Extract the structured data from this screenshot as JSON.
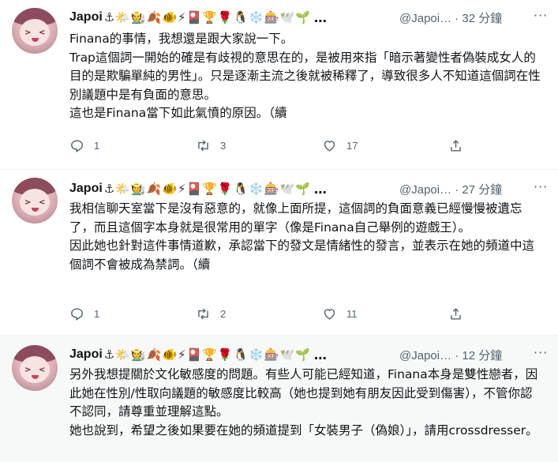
{
  "tweets": [
    {
      "name": "Japoi",
      "emojis": "⚓🌤️🧑‍🌾🍂🐠⚡🎴🏆🌹🐧❄️🎰🕊️🌱",
      "ellipsis": "…",
      "handle": "@Japoi…",
      "time": "· 32 分鐘",
      "text": "Finana的事情，我想還是跟大家說一下。\nTrap這個詞一開始的確是有歧視的意思在的，是被用來指「暗示著變性者偽裝成女人的目的是欺騙單純的男性」。只是逐漸主流之後就被稀釋了，導致很多人不知道這個詞在性別議題中是有負面的意思。\n這也是Finana當下如此氣憤的原因。（續",
      "replies": "1",
      "retweets": "3",
      "likes": "17"
    },
    {
      "name": "Japoi",
      "emojis": "⚓🌤️🧑‍🌾🍂🐠⚡🎴🏆🌹🐧❄️🎰🕊️🌱",
      "ellipsis": "…",
      "handle": "@Japoi…",
      "time": "· 27 分鐘",
      "text": "我相信聊天室當下是沒有惡意的，就像上面所提，這個詞的負面意義已經慢慢被遺忘了，而且這個字本身就是很常用的單字（像是Finana自己舉例的遊戲王）。\n因此她也針對這件事情道歉，承認當下的發文是情緒性的發言，並表示在她的頻道中這個詞不會被成為禁詞。（續",
      "replies": "1",
      "retweets": "2",
      "likes": "11"
    },
    {
      "name": "Japoi",
      "emojis": "⚓🌤️🧑‍🌾🍂🐠⚡🎴🏆🌹🐧❄️🎰🕊️🌱",
      "ellipsis": "…",
      "handle": "@Japoi…",
      "time": "· 12 分鐘",
      "text": "另外我想提關於文化敏感度的問題。有些人可能已經知道，Finana本身是雙性戀者，因此她在性別/性取向議題的敏感度比較高（她也提到她有朋友因此受到傷害），不管你認不認同，請尊重並理解這點。\n她也說到，希望之後如果要在她的頻道提到「女裝男子（偽娘）」，請用crossdresser。"
    }
  ],
  "more_glyph": "···"
}
